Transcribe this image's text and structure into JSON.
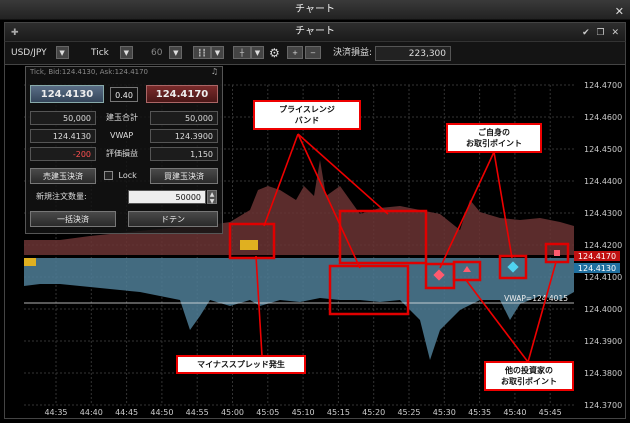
{
  "window": {
    "outer_title": "チャート",
    "inner_title": "チャート",
    "close": "✕",
    "win_buttons": "✔ ❐ ✕"
  },
  "toolbar": {
    "pair": "USD/JPY",
    "timeframe": "Tick",
    "count": "60",
    "pl_label": "決済損益:",
    "pl_value": "223,300"
  },
  "panel": {
    "info": "Tick, Bid:124.4130, Ask:124.4170",
    "bid": "124.4130",
    "spread": "0.40",
    "ask": "124.4170",
    "rows": [
      {
        "left": "50,000",
        "label": "建玉合計",
        "right": "50,000"
      },
      {
        "left": "124.4130",
        "label": "VWAP",
        "right": "124.3900"
      },
      {
        "left": "-200",
        "label": "評価損益",
        "right": "1,150"
      }
    ],
    "sell_close": "売建玉決済",
    "lock": "Lock",
    "buy_close": "買建玉決済",
    "qty_label": "新規注文数量:",
    "qty_value": "50000",
    "close_all": "一括決済",
    "doten": "ドテン"
  },
  "axis": {
    "y_ticks": [
      "124.4700",
      "124.4600",
      "124.4500",
      "124.4400",
      "124.4300",
      "124.4200",
      "124.4100",
      "124.4000",
      "124.3900",
      "124.3800",
      "124.3700"
    ],
    "x_ticks": [
      "44:35",
      "44:40",
      "44:45",
      "44:50",
      "44:55",
      "45:00",
      "45:05",
      "45:10",
      "45:15",
      "45:20",
      "45:25",
      "45:30",
      "45:35",
      "45:40",
      "45:45"
    ],
    "ask_tag": "124.4170",
    "bid_tag": "124.4130",
    "vwap_label": "VWAP=124.4015"
  },
  "callouts": {
    "price_range": "プライスレンジ\nバンド",
    "own_points": "ご自身の\nお取引ポイント",
    "negative_spread": "マイナススプレッド発生",
    "others_points": "他の投資家の\nお取引ポイント"
  },
  "colors": {
    "ask_band": "#6b3434",
    "bid_band": "#4f7e96",
    "highlight": "#e00000",
    "marker_own": "#ff5a6e",
    "marker_other": "#4fd3f0"
  }
}
